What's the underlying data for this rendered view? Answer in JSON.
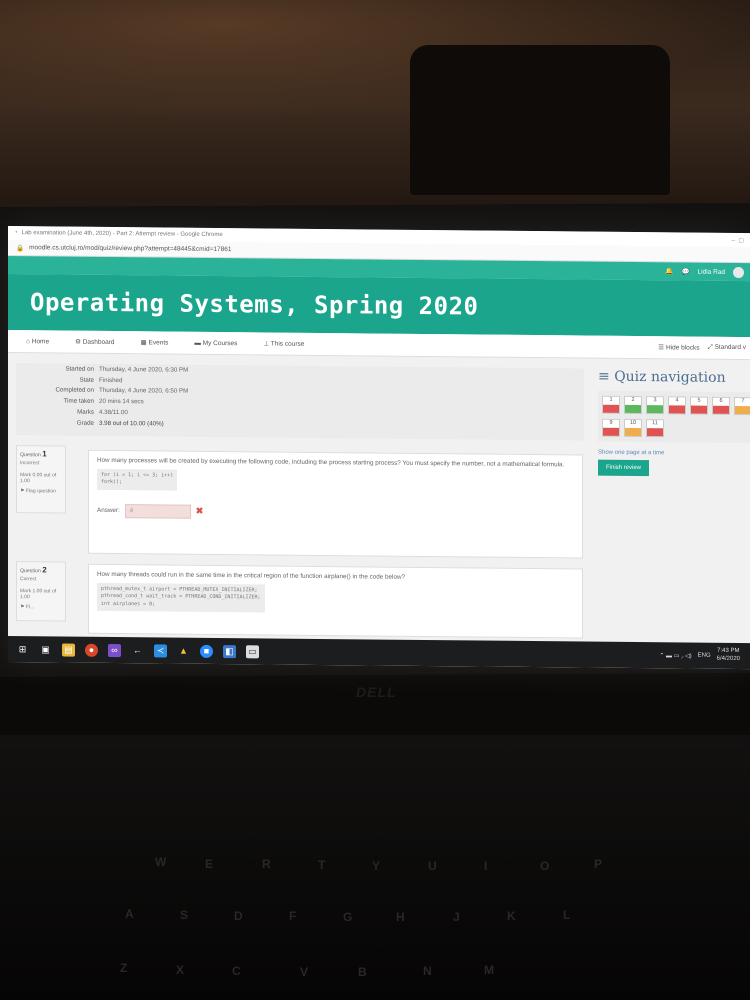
{
  "browser": {
    "tab_title": "Lab examination (June 4th, 2020) - Part 2: Attempt review - Google Chrome",
    "url": "moodle.cs.utcluj.ro/mod/quiz/review.php?attempt=48445&cmid=17861"
  },
  "topnav": {
    "user_name": "Lidia Rad"
  },
  "banner": {
    "title": "Operating Systems, Spring 2020"
  },
  "menu": {
    "items": [
      "Home",
      "Dashboard",
      "Events",
      "My Courses",
      "This course"
    ],
    "hide_blocks": "Hide blocks",
    "standard": "Standard v"
  },
  "summary": {
    "rows": [
      {
        "label": "Started on",
        "value": "Thursday, 4 June 2020, 6:30 PM"
      },
      {
        "label": "State",
        "value": "Finished"
      },
      {
        "label": "Completed on",
        "value": "Thursday, 4 June 2020, 6:50 PM"
      },
      {
        "label": "Time taken",
        "value": "20 mins 14 secs"
      },
      {
        "label": "Marks",
        "value": "4.38/11.00"
      },
      {
        "label": "Grade",
        "value": "3.98 out of 10.00 (40%)"
      }
    ]
  },
  "questions": [
    {
      "number_label": "Question",
      "number": "1",
      "status": "Incorrect",
      "mark": "Mark 0.00 out of 1.00",
      "flag": "Flag question",
      "text": "How many processes will be created by executing the following code, including the process starting process? You must specify the number, not a mathematical formula.",
      "code": [
        "for (i = 1; i <= 3; i++)",
        "    fork();"
      ],
      "answer_label": "Answer:",
      "answer_value": "4"
    },
    {
      "number_label": "Question",
      "number": "2",
      "status": "Correct",
      "mark": "Mark 1.00 out of 1.00",
      "flag": "Fl...",
      "text": "How many threads could run in the same time in the critical region of the function airplane() in the code below?",
      "code": [
        "pthread_mutex_t airport = PTHREAD_MUTEX_INITIALIZER;",
        "pthread_cond_t wait_track = PTHREAD_COND_INITIALIZER;",
        "int airplanes = 0;"
      ]
    }
  ],
  "quiz_nav": {
    "title": "Quiz navigation",
    "buttons": [
      {
        "n": "1",
        "state": "incorrect"
      },
      {
        "n": "2",
        "state": "correct"
      },
      {
        "n": "3",
        "state": "correct"
      },
      {
        "n": "4",
        "state": "incorrect"
      },
      {
        "n": "5",
        "state": "incorrect"
      },
      {
        "n": "6",
        "state": "incorrect"
      },
      {
        "n": "7",
        "state": "partial"
      },
      {
        "n": "9",
        "state": "incorrect"
      },
      {
        "n": "10",
        "state": "partial"
      },
      {
        "n": "11",
        "state": "incorrect"
      }
    ],
    "show_one_page": "Show one page at a time",
    "finish_review": "Finish review",
    "colors": {
      "incorrect": "#e05353",
      "correct": "#5cb85c",
      "partial": "#f0ad4e"
    }
  },
  "taskbar": {
    "lang": "ENG",
    "time": "7:43 PM",
    "date": "6/4/2020"
  },
  "device": {
    "brand": "DELL"
  },
  "keyboard": {
    "keys": [
      "W",
      "E",
      "R",
      "T",
      "Y",
      "U",
      "I",
      "O",
      "P",
      "A",
      "S",
      "D",
      "F",
      "G",
      "H",
      "J",
      "K",
      "L",
      "Z",
      "X",
      "C",
      "V",
      "B",
      "N",
      "M"
    ]
  }
}
